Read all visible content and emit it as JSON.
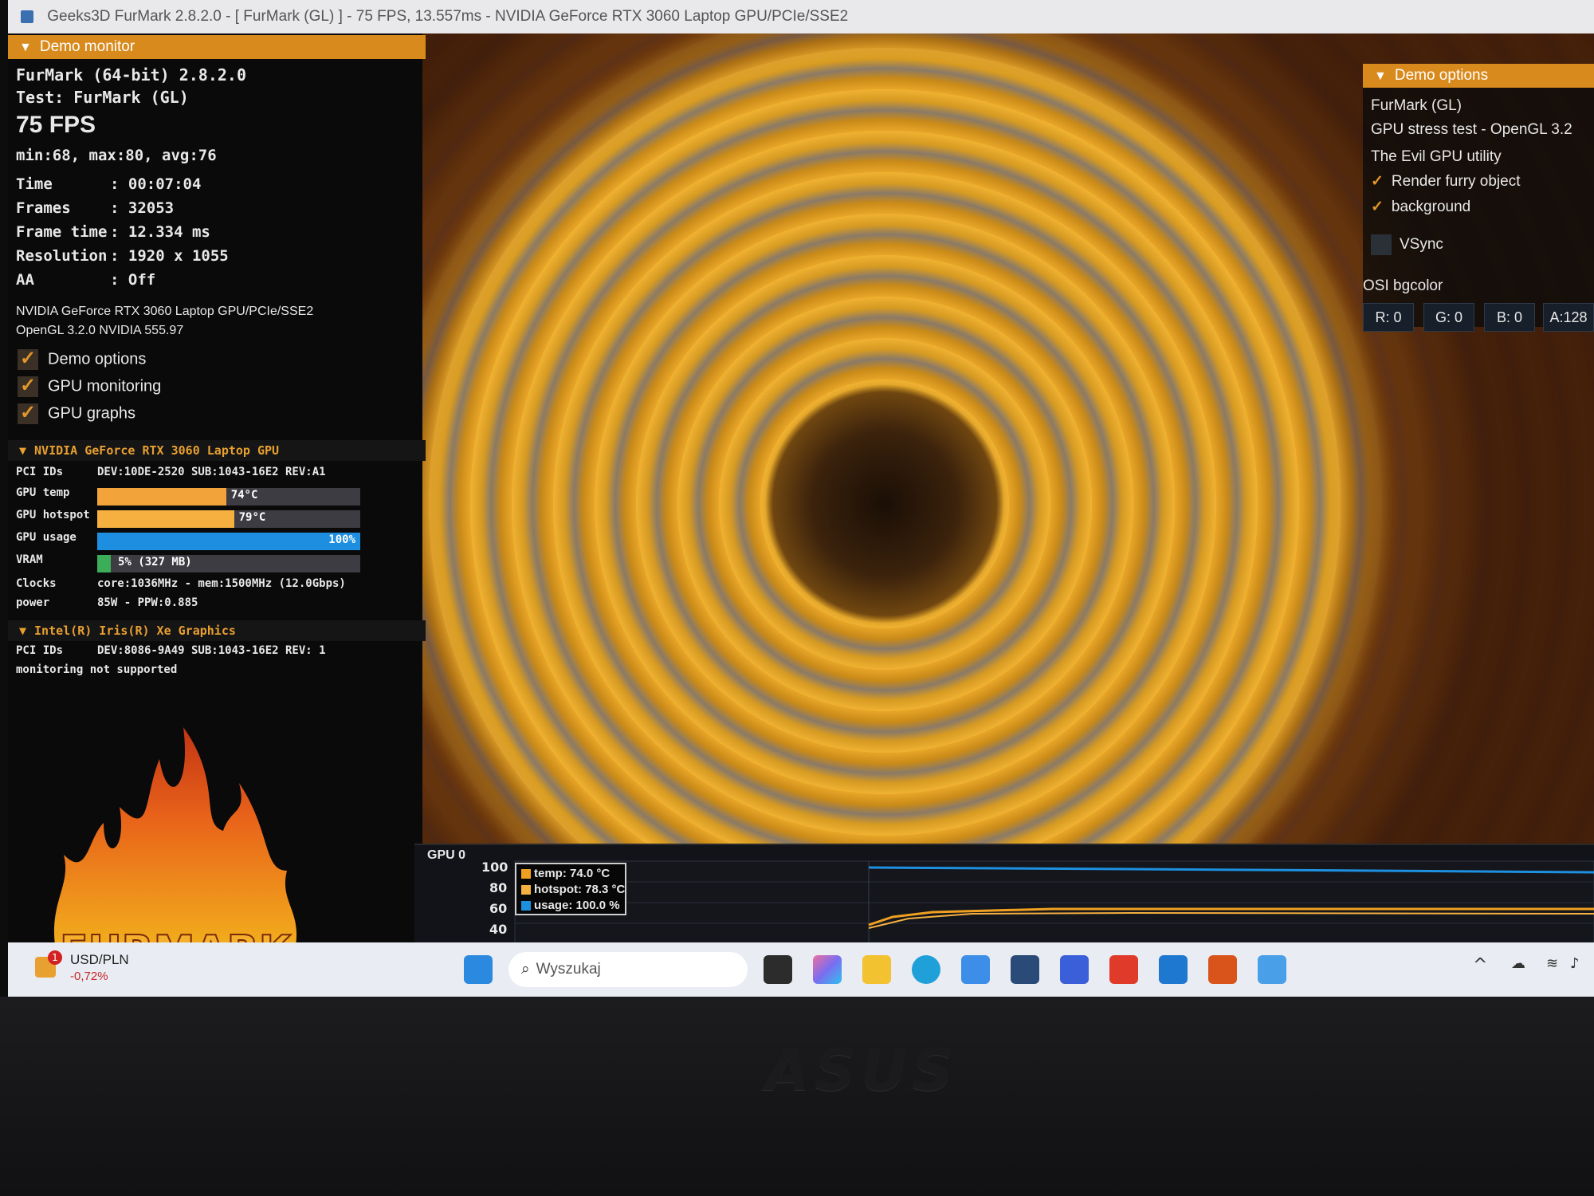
{
  "window": {
    "title": "Geeks3D FurMark 2.8.2.0 - [ FurMark (GL) ] - 75 FPS, 13.557ms - NVIDIA GeForce RTX 3060 Laptop GPU/PCIe/SSE2"
  },
  "demo_monitor": {
    "header": "Demo monitor",
    "app_version": "FurMark (64-bit) 2.8.2.0",
    "test": "Test: FurMark (GL)",
    "fps": "75 FPS",
    "fps_stats": "min:68, max:80, avg:76",
    "stats": [
      {
        "label": "Time",
        "value": ": 00:07:04"
      },
      {
        "label": "Frames",
        "value": ": 32053"
      },
      {
        "label": "Frame time",
        "value": ": 12.334 ms"
      },
      {
        "label": "Resolution",
        "value": ": 1920 x 1055"
      },
      {
        "label": "AA",
        "value": ": Off"
      }
    ],
    "renderer": "NVIDIA GeForce RTX 3060 Laptop GPU/PCIe/SSE2",
    "opengl": "OpenGL 3.2.0 NVIDIA 555.97",
    "toggles": [
      {
        "label": "Demo options",
        "checked": true
      },
      {
        "label": "GPU monitoring",
        "checked": true
      },
      {
        "label": "GPU graphs",
        "checked": true
      }
    ]
  },
  "gpu_nvidia": {
    "header": "NVIDIA GeForce RTX 3060 Laptop GPU",
    "pci_label": "PCI IDs",
    "pci_value": "DEV:10DE-2520 SUB:1043-16E2 REV:A1",
    "temp_label": "GPU temp",
    "temp_value": "74°C",
    "temp_fraction": 0.49,
    "hotspot_label": "GPU hotspot",
    "hotspot_value": "79°C",
    "hotspot_fraction": 0.52,
    "usage_label": "GPU usage",
    "usage_value": "100%",
    "usage_fraction": 1.0,
    "vram_label": "VRAM",
    "vram_value": "5% (327 MB)",
    "vram_fraction": 0.05,
    "clocks_label": "Clocks",
    "clocks_value": "core:1036MHz - mem:1500MHz (12.0Gbps)",
    "power_label": "power",
    "power_value": "85W - PPW:0.885"
  },
  "gpu_intel": {
    "header": "Intel(R) Iris(R) Xe Graphics",
    "pci_label": "PCI IDs",
    "pci_value": "DEV:8086-9A49 SUB:1043-16E2 REV: 1",
    "monitoring": "monitoring not supported"
  },
  "demo_options": {
    "header": "Demo options",
    "name": "FurMark (GL)",
    "desc": "GPU stress test - OpenGL 3.2",
    "tagline": "The Evil GPU utility",
    "render_furry": "Render furry object",
    "background": "background",
    "vsync": "VSync",
    "osi_label": "OSI bgcolor",
    "r": "R: 0",
    "g": "G: 0",
    "b": "B: 0",
    "a": "A:128"
  },
  "logo_text": "FURMARK",
  "graph": {
    "label": "GPU 0",
    "ticks": [
      "100",
      "80",
      "60",
      "40"
    ],
    "legend_temp": "temp: 74.0 °C",
    "legend_hotspot": "hotspot: 78.3 °C",
    "legend_usage": "usage: 100.0 %",
    "colors": {
      "temp": "#f0a020",
      "hotspot": "#f5b040",
      "usage": "#1e90e0"
    }
  },
  "taskbar": {
    "widget_title": "USD/PLN",
    "widget_value": "-0,72%",
    "widget_badge": "1",
    "search_placeholder": "Wyszukaj"
  },
  "bezel_brand": "ASUS"
}
